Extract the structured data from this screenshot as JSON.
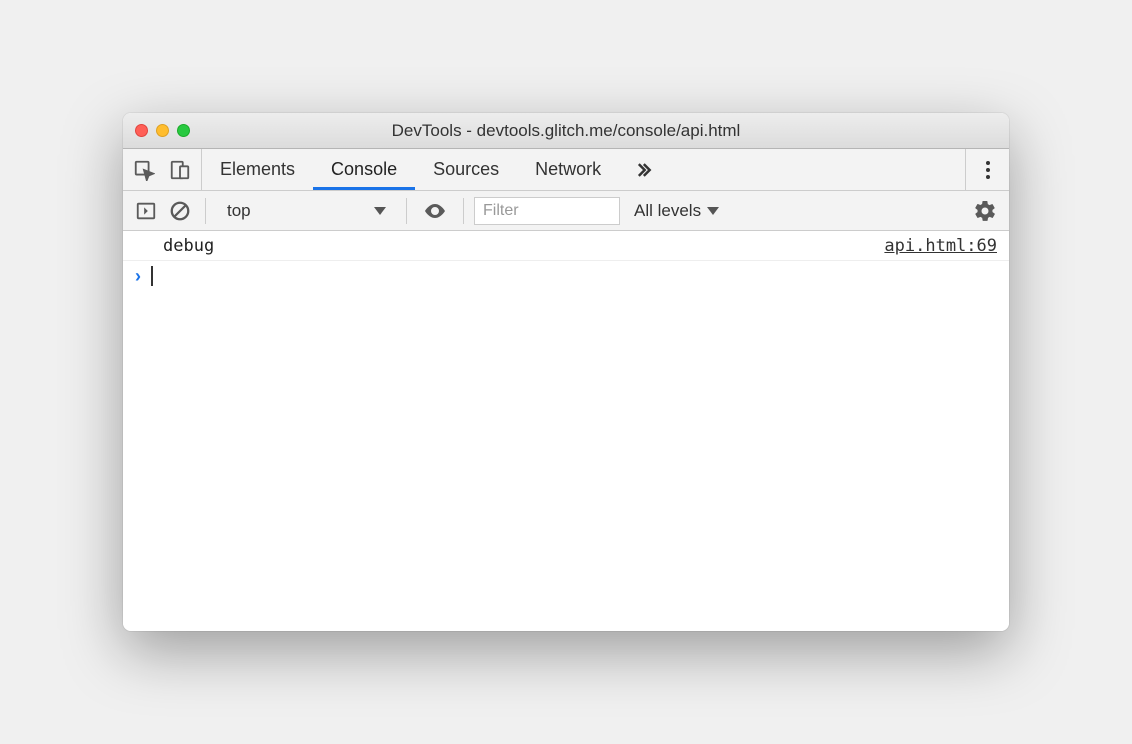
{
  "window": {
    "title": "DevTools - devtools.glitch.me/console/api.html"
  },
  "tabs": {
    "elements": "Elements",
    "console": "Console",
    "sources": "Sources",
    "network": "Network"
  },
  "toolbar": {
    "context": "top",
    "filter_placeholder": "Filter",
    "levels": "All levels"
  },
  "log": {
    "message": "debug",
    "source": "api.html:69"
  }
}
